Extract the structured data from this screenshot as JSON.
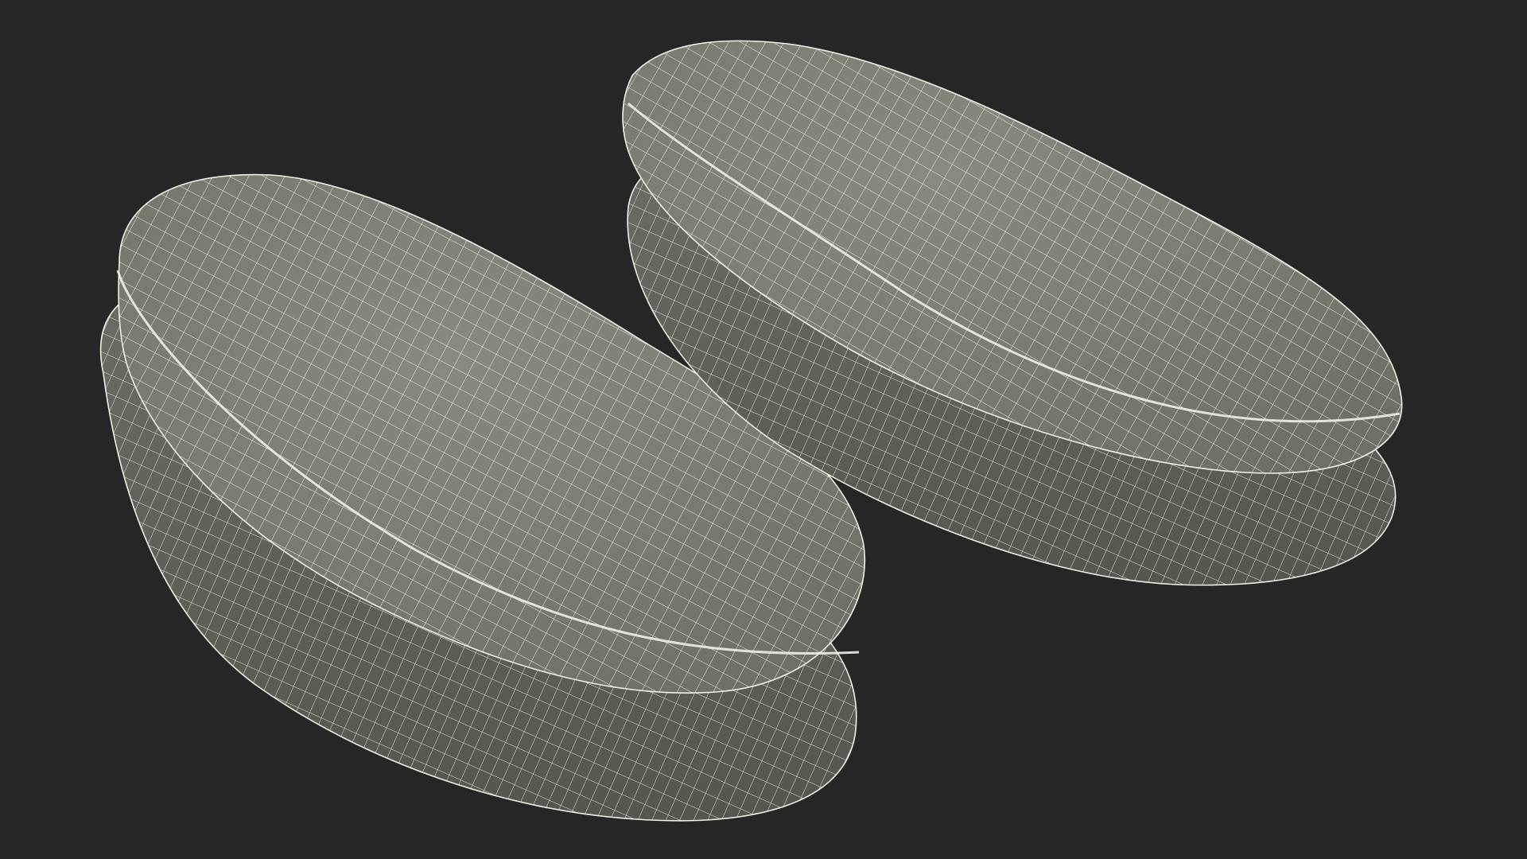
{
  "scene": {
    "background_color": "#262626",
    "surface_color": "#7d7d73",
    "surface_shadow_color": "#5e5e56",
    "wire_color": "#f2f0e6",
    "objects": [
      {
        "name": "left-pad"
      },
      {
        "name": "right-pad"
      }
    ]
  }
}
